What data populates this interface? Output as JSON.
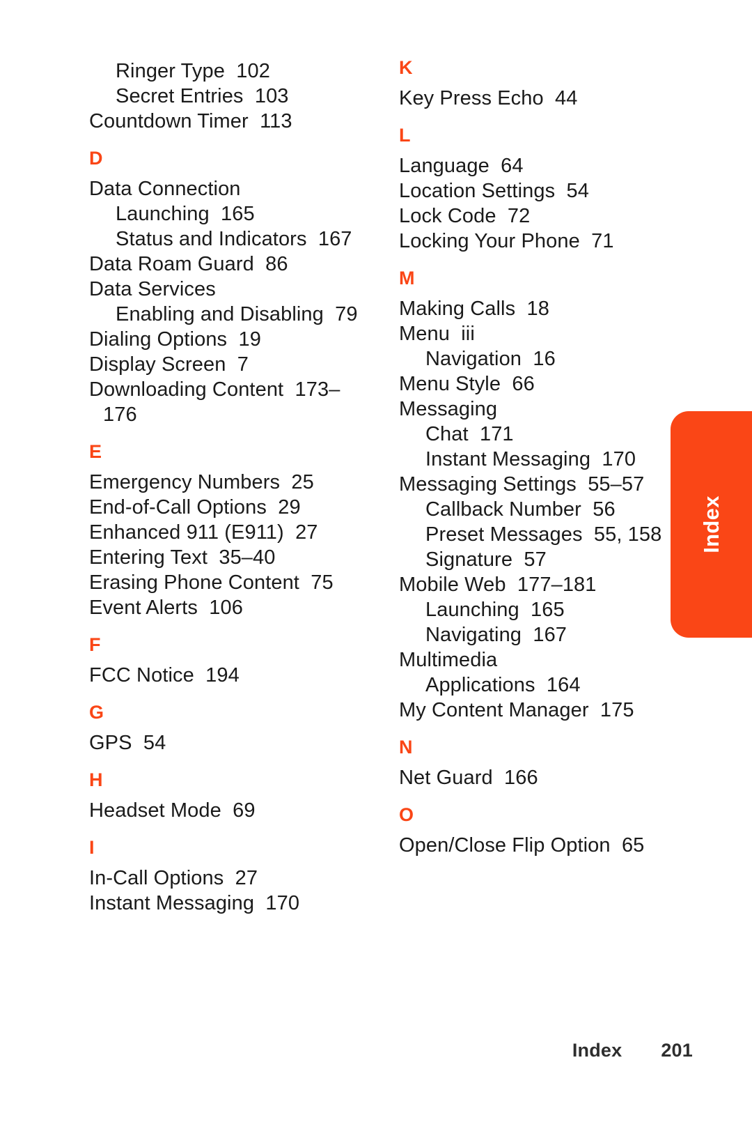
{
  "document": {
    "type": "index",
    "side_tab_label": "Index",
    "accent_color": "#fa4616",
    "text_color": "#1a1a1a"
  },
  "footer": {
    "label": "Index",
    "page_number": "201"
  },
  "columns": [
    {
      "name": "left-column",
      "blocks": [
        {
          "letter": null,
          "entries": [
            {
              "level": 2,
              "text": "Ringer Type  102"
            },
            {
              "level": 2,
              "text": "Secret Entries  103"
            },
            {
              "level": 1,
              "text": "Countdown Timer  113"
            }
          ]
        },
        {
          "letter": "D",
          "entries": [
            {
              "level": 1,
              "text": "Data Connection"
            },
            {
              "level": 2,
              "text": "Launching  165"
            },
            {
              "level": 2,
              "text": "Status and Indicators  167"
            },
            {
              "level": 1,
              "text": "Data Roam Guard  86"
            },
            {
              "level": 1,
              "text": "Data Services"
            },
            {
              "level": 2,
              "text": "Enabling and Disabling  79"
            },
            {
              "level": 1,
              "text": "Dialing Options  19"
            },
            {
              "level": 1,
              "text": "Display Screen  7"
            },
            {
              "level": 1,
              "text": "Downloading Content  173–"
            },
            {
              "level": 1,
              "cont": true,
              "text": "176"
            }
          ]
        },
        {
          "letter": "E",
          "entries": [
            {
              "level": 1,
              "text": "Emergency Numbers  25"
            },
            {
              "level": 1,
              "text": "End-of-Call Options  29"
            },
            {
              "level": 1,
              "text": "Enhanced 911 (E911)  27"
            },
            {
              "level": 1,
              "text": "Entering Text  35–40"
            },
            {
              "level": 1,
              "text": "Erasing Phone Content  75"
            },
            {
              "level": 1,
              "text": "Event Alerts  106"
            }
          ]
        },
        {
          "letter": "F",
          "entries": [
            {
              "level": 1,
              "text": "FCC Notice  194"
            }
          ]
        },
        {
          "letter": "G",
          "entries": [
            {
              "level": 1,
              "text": "GPS  54"
            }
          ]
        },
        {
          "letter": "H",
          "entries": [
            {
              "level": 1,
              "text": "Headset Mode  69"
            }
          ]
        },
        {
          "letter": "I",
          "entries": [
            {
              "level": 1,
              "text": "In-Call Options  27"
            },
            {
              "level": 1,
              "text": "Instant Messaging  170"
            }
          ]
        }
      ]
    },
    {
      "name": "right-column",
      "blocks": [
        {
          "letter": "K",
          "entries": [
            {
              "level": 1,
              "text": "Key Press Echo  44"
            }
          ]
        },
        {
          "letter": "L",
          "entries": [
            {
              "level": 1,
              "text": "Language  64"
            },
            {
              "level": 1,
              "text": "Location Settings  54"
            },
            {
              "level": 1,
              "text": "Lock Code  72"
            },
            {
              "level": 1,
              "text": "Locking Your Phone  71"
            }
          ]
        },
        {
          "letter": "M",
          "entries": [
            {
              "level": 1,
              "text": "Making Calls  18"
            },
            {
              "level": 1,
              "text": "Menu  iii"
            },
            {
              "level": 2,
              "text": "Navigation  16"
            },
            {
              "level": 1,
              "text": "Menu Style  66"
            },
            {
              "level": 1,
              "text": "Messaging"
            },
            {
              "level": 2,
              "text": "Chat  171"
            },
            {
              "level": 2,
              "text": "Instant Messaging  170"
            },
            {
              "level": 1,
              "text": "Messaging Settings  55–57"
            },
            {
              "level": 2,
              "text": "Callback Number  56"
            },
            {
              "level": 2,
              "text": "Preset Messages  55, 158"
            },
            {
              "level": 2,
              "text": "Signature  57"
            },
            {
              "level": 1,
              "text": "Mobile Web  177–181"
            },
            {
              "level": 2,
              "text": "Launching  165"
            },
            {
              "level": 2,
              "text": "Navigating  167"
            },
            {
              "level": 1,
              "text": "Multimedia"
            },
            {
              "level": 2,
              "text": "Applications  164"
            },
            {
              "level": 1,
              "text": "My Content Manager  175"
            }
          ]
        },
        {
          "letter": "N",
          "entries": [
            {
              "level": 1,
              "text": "Net Guard  166"
            }
          ]
        },
        {
          "letter": "O",
          "entries": [
            {
              "level": 1,
              "text": "Open/Close Flip Option  65"
            }
          ]
        }
      ]
    }
  ]
}
